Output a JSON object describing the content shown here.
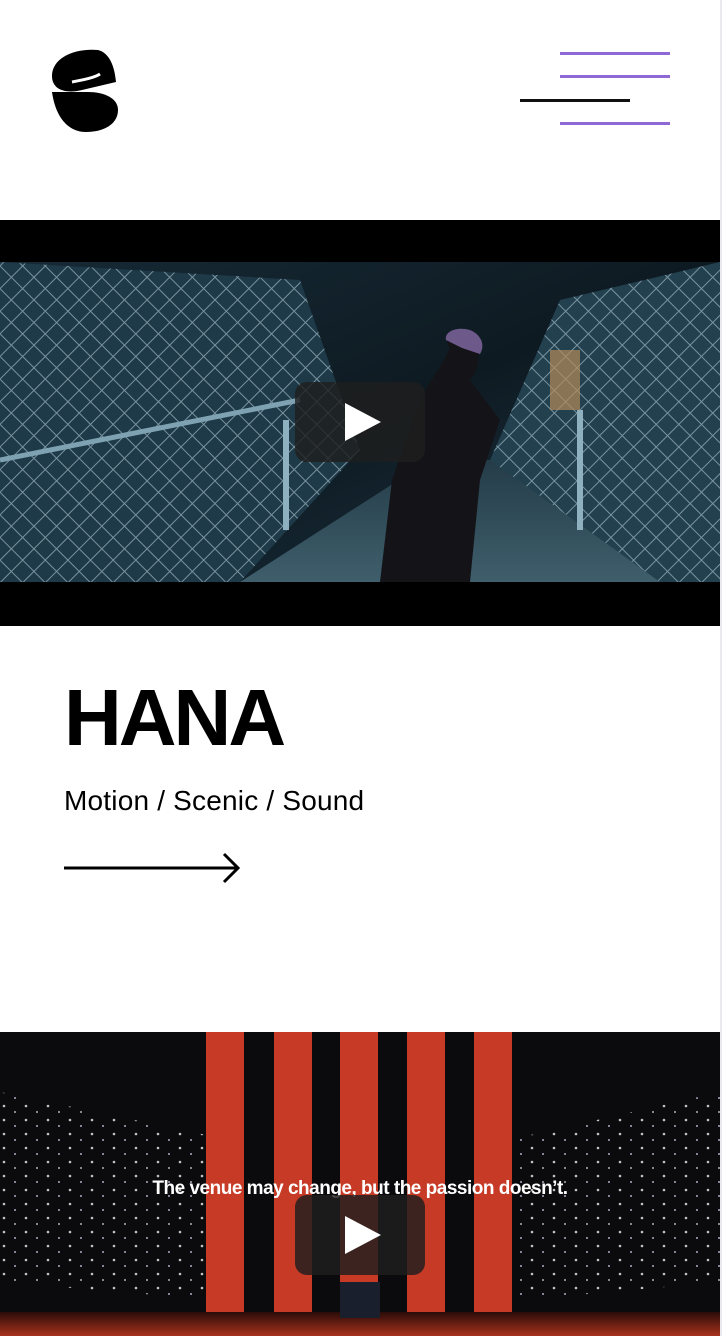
{
  "header": {
    "logo_icon": "s-swirl-logo-icon",
    "menu_icon": "hamburger-menu-icon",
    "menu_colors": {
      "accent": "#8e68d4",
      "primary": "#111111"
    }
  },
  "featured_video": {
    "play_icon": "play-icon"
  },
  "project": {
    "title": "HANA",
    "subtitle": "Motion / Scenic / Sound",
    "link_icon": "arrow-right-icon"
  },
  "next_video": {
    "caption": "The venue may change, but the passion doesn’t.",
    "play_icon": "play-icon"
  }
}
